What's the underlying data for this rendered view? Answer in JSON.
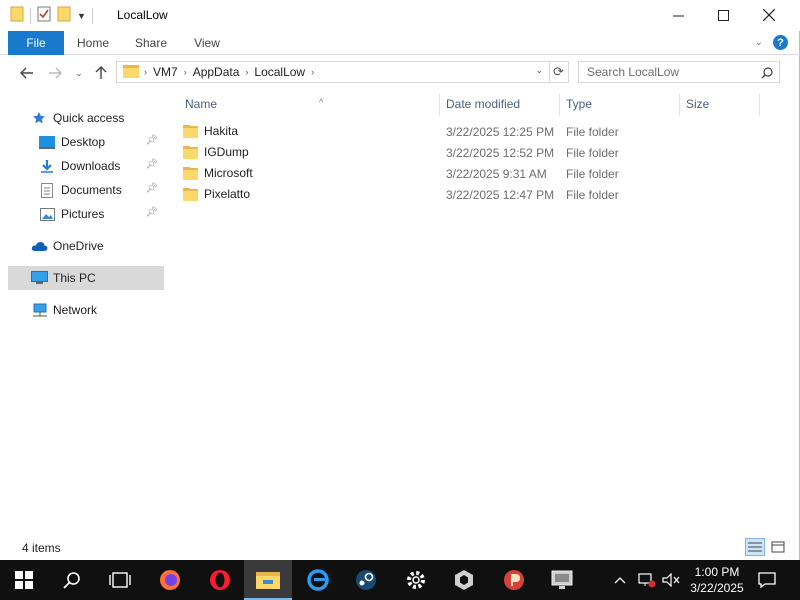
{
  "window": {
    "title": "LocalLow"
  },
  "ribbon": {
    "tabs": [
      "File",
      "Home",
      "Share",
      "View"
    ]
  },
  "address": {
    "crumbs": [
      "VM7",
      "AppData",
      "LocalLow"
    ],
    "search_placeholder": "Search LocalLow"
  },
  "navpane": {
    "items": [
      {
        "label": "Quick access",
        "icon": "star-icon"
      },
      {
        "label": "Desktop",
        "icon": "desktop-icon",
        "pinned": true
      },
      {
        "label": "Downloads",
        "icon": "download-icon",
        "pinned": true
      },
      {
        "label": "Documents",
        "icon": "documents-icon",
        "pinned": true
      },
      {
        "label": "Pictures",
        "icon": "pictures-icon",
        "pinned": true
      },
      {
        "label": "OneDrive",
        "icon": "cloud-icon"
      },
      {
        "label": "This PC",
        "icon": "computer-icon",
        "selected": true
      },
      {
        "label": "Network",
        "icon": "network-icon"
      }
    ]
  },
  "columns": {
    "name": "Name",
    "date": "Date modified",
    "type": "Type",
    "size": "Size"
  },
  "files": [
    {
      "name": "Hakita",
      "date": "3/22/2025 12:25 PM",
      "type": "File folder"
    },
    {
      "name": "IGDump",
      "date": "3/22/2025 12:52 PM",
      "type": "File folder"
    },
    {
      "name": "Microsoft",
      "date": "3/22/2025 9:31 AM",
      "type": "File folder"
    },
    {
      "name": "Pixelatto",
      "date": "3/22/2025 12:47 PM",
      "type": "File folder"
    }
  ],
  "status": {
    "item_count": "4 items"
  },
  "clock": {
    "time": "1:00 PM",
    "date": "3/22/2025"
  },
  "colors": {
    "accent": "#1979ca",
    "folder": "#fcd86b",
    "taskbar": "#101010"
  }
}
